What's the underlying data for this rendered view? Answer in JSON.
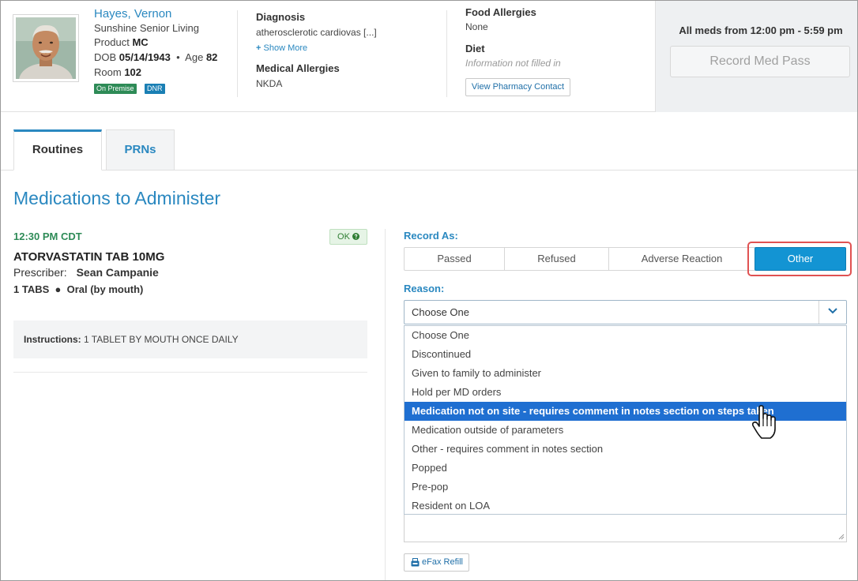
{
  "resident": {
    "name": "Hayes, Vernon",
    "facility": "Sunshine Senior Living",
    "product_label": "Product",
    "product_value": "MC",
    "dob_label": "DOB",
    "dob_value": "05/14/1943",
    "age_label": "Age",
    "age_value": "82",
    "room_label": "Room",
    "room_value": "102",
    "badges": [
      "On Premise",
      "DNR"
    ]
  },
  "diagnosis": {
    "label": "Diagnosis",
    "value": "atherosclerotic cardiovas [...]",
    "show_more": "Show More"
  },
  "medical_allergies": {
    "label": "Medical Allergies",
    "value": "NKDA"
  },
  "food_allergies": {
    "label": "Food Allergies",
    "value": "None"
  },
  "diet": {
    "label": "Diet",
    "value": "Information not filled in"
  },
  "pharmacy_button": "View Pharmacy Contact",
  "meds_window": {
    "text": "All meds from 12:00 pm - 5:59 pm",
    "record_button": "Record Med Pass"
  },
  "tabs": [
    {
      "label": "Routines",
      "active": true
    },
    {
      "label": "PRNs",
      "active": false
    }
  ],
  "section_title": "Medications to Administer",
  "medication": {
    "time": "12:30 PM CDT",
    "status": "OK",
    "name": "ATORVASTATIN TAB 10MG",
    "prescriber_label": "Prescriber:",
    "prescriber": "Sean Campanie",
    "quantity": "1 TABS",
    "route": "Oral (by mouth)",
    "instructions_label": "Instructions:",
    "instructions": "1 TABLET BY MOUTH ONCE DAILY"
  },
  "record_as": {
    "label": "Record As:",
    "options": [
      "Passed",
      "Refused",
      "Adverse Reaction",
      "Other"
    ],
    "selected": "Other"
  },
  "reason": {
    "label": "Reason:",
    "selected_display": "Choose One",
    "options": [
      "Choose One",
      "Discontinued",
      "Given to family to administer",
      "Hold per MD orders",
      "Medication not on site - requires comment in notes section on steps taken",
      "Medication outside of parameters",
      "Other - requires comment in notes section",
      "Popped",
      "Pre-pop",
      "Resident on LOA"
    ],
    "highlighted_index": 4
  },
  "efax_button": "eFax Refill",
  "colors": {
    "accent": "#2a88c0",
    "primary_button": "#1394d3",
    "highlight": "#1f6fd1",
    "success": "#2e8b57",
    "callout": "#e05252"
  }
}
